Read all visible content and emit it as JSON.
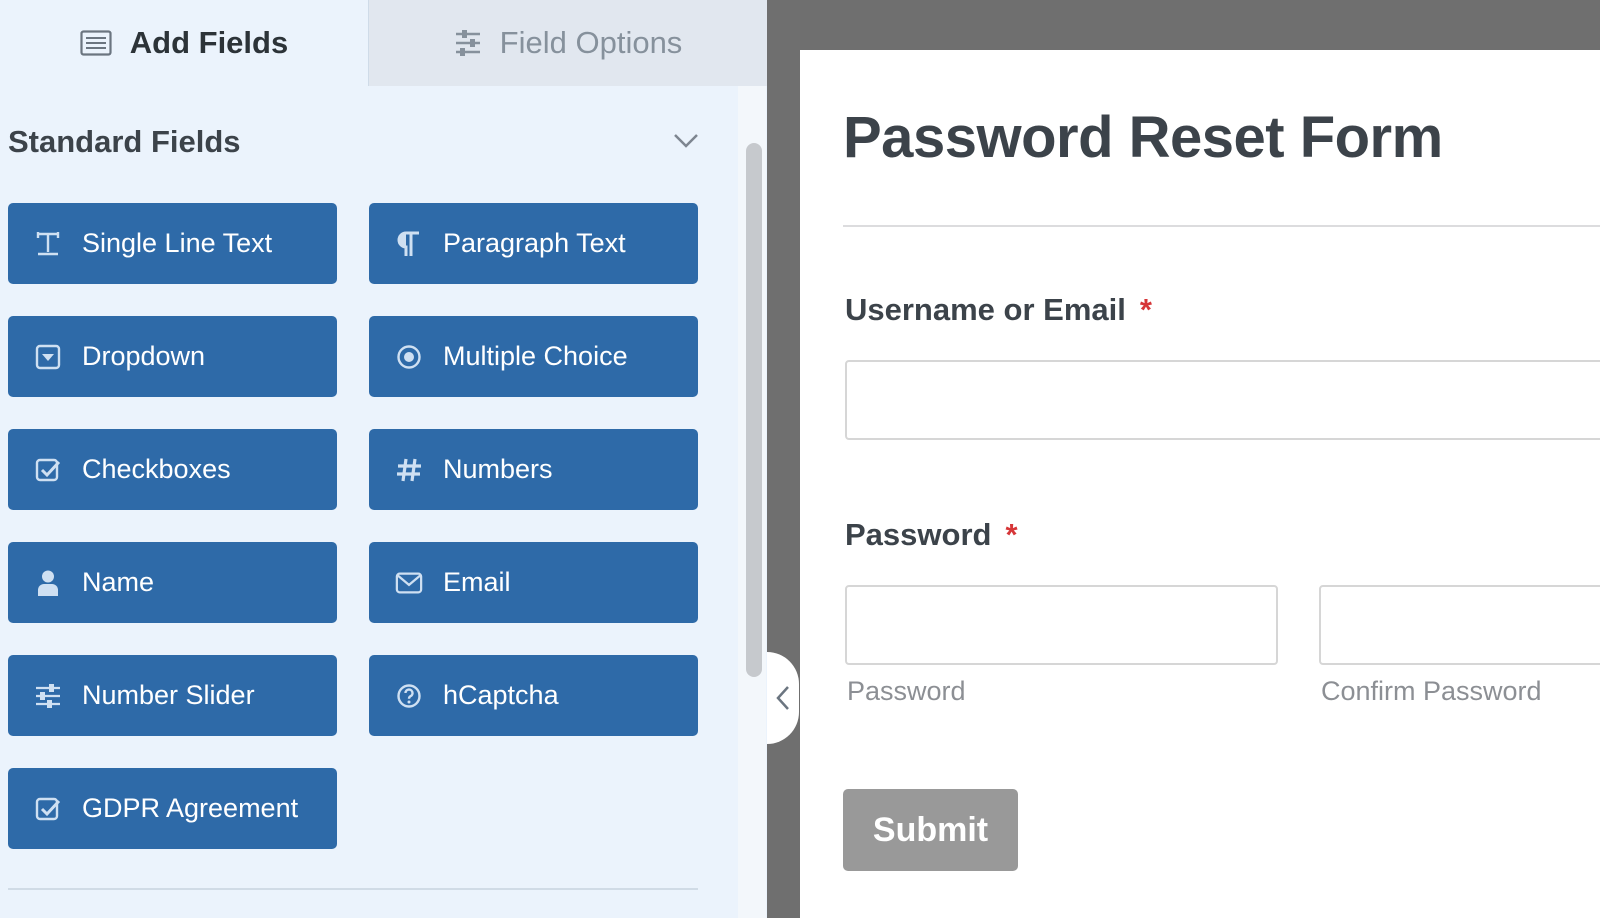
{
  "tabs": {
    "add_fields": "Add Fields",
    "field_options": "Field Options"
  },
  "section": {
    "title": "Standard Fields"
  },
  "fields": [
    {
      "label": "Single Line Text",
      "icon": "text-cursor-icon"
    },
    {
      "label": "Paragraph Text",
      "icon": "paragraph-icon"
    },
    {
      "label": "Dropdown",
      "icon": "dropdown-icon"
    },
    {
      "label": "Multiple Choice",
      "icon": "radio-icon"
    },
    {
      "label": "Checkboxes",
      "icon": "checkbox-icon"
    },
    {
      "label": "Numbers",
      "icon": "hash-icon"
    },
    {
      "label": "Name",
      "icon": "user-icon"
    },
    {
      "label": "Email",
      "icon": "envelope-icon"
    },
    {
      "label": "Number Slider",
      "icon": "sliders-icon"
    },
    {
      "label": "hCaptcha",
      "icon": "question-circle-icon"
    },
    {
      "label": "GDPR Agreement",
      "icon": "checkbox-icon"
    }
  ],
  "form": {
    "title": "Password Reset Form",
    "username_label": "Username or Email",
    "password_label": "Password",
    "required_mark": "*",
    "password_sublabel": "Password",
    "confirm_sublabel": "Confirm Password",
    "submit_label": "Submit"
  },
  "colors": {
    "field_button": "#2e6aa8",
    "panel_bg": "#ebf3fc",
    "required": "#d63638",
    "submit_bg": "#999999"
  }
}
